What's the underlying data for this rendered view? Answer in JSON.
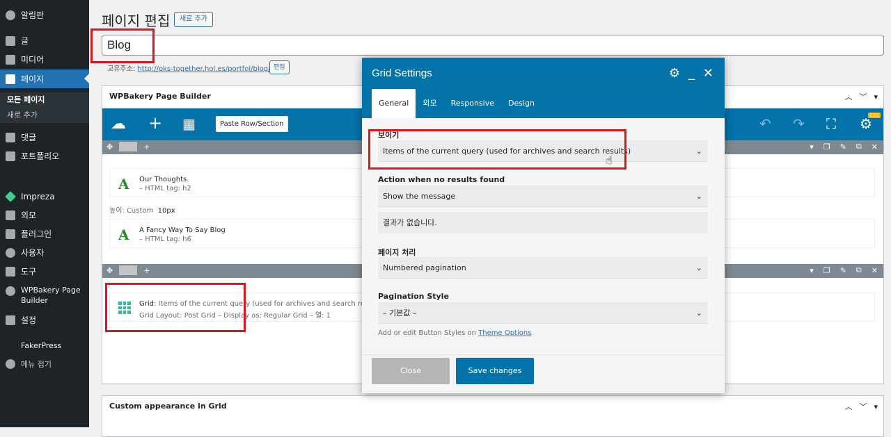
{
  "sidebar": {
    "items": [
      {
        "label": "알림판",
        "icon": "dashboard-icon"
      },
      {
        "label": "글",
        "icon": "pin-icon"
      },
      {
        "label": "미디어",
        "icon": "media-icon"
      },
      {
        "label": "페이지",
        "icon": "page-icon"
      },
      {
        "label": "댓글",
        "icon": "comment-icon"
      },
      {
        "label": "포트폴리오",
        "icon": "portfolio-icon"
      },
      {
        "label": "Impreza",
        "icon": "gem-icon"
      },
      {
        "label": "외모",
        "icon": "brush-icon"
      },
      {
        "label": "플러그인",
        "icon": "plugin-icon"
      },
      {
        "label": "사용자",
        "icon": "user-icon"
      },
      {
        "label": "도구",
        "icon": "wrench-icon"
      },
      {
        "label": "WPBakery Page Builder",
        "icon": "cloud-icon"
      },
      {
        "label": "설정",
        "icon": "settings-icon"
      },
      {
        "label": "FakerPress",
        "icon": ""
      },
      {
        "label": "메뉴 접기",
        "icon": "collapse-icon"
      }
    ],
    "sub": [
      "모든 페이지",
      "새로 추가"
    ]
  },
  "header": {
    "title": "페이지 편집",
    "add_new": "새로 추가",
    "post_title": "Blog",
    "permalink_label": "고유주소:",
    "permalink_url": "http://oks-together.hol.es/portfol/blog/",
    "edit_label": "편집"
  },
  "builder": {
    "title": "WPBakery Page Builder",
    "paste_label": "Paste Row/Section",
    "css_badge": "CSS",
    "elements": [
      {
        "title": "Our Thoughts.",
        "sub": "– HTML tag: h2"
      },
      {
        "title": "A Fancy Way To Say Blog",
        "sub": "– HTML tag: h6"
      }
    ],
    "height_label": "높이: Custom",
    "height_value": "10px",
    "grid_title": "Grid",
    "grid_desc": ": Items of the current query (used for archives and search results)",
    "grid_sub": "Grid Layout: Post Grid – Display as: Regular Grid – 열: 1"
  },
  "custom_panel": {
    "title": "Custom appearance in Grid"
  },
  "modal": {
    "title": "Grid Settings",
    "tabs": [
      "General",
      "외모",
      "Responsive",
      "Design"
    ],
    "fields": {
      "show_label": "보이기",
      "show_value": "Items of the current query (used for archives and search results)",
      "no_results_label": "Action when no results found",
      "no_results_value": "Show the message",
      "message_value": "결과가 없습니다.",
      "pagination_label": "페이지 처리",
      "pagination_value": "Numbered pagination",
      "pagination_style_label": "Pagination Style",
      "pagination_style_value": "– 기본값 –",
      "help_text": "Add or edit Button Styles on",
      "help_link": "Theme Options"
    },
    "close_label": "Close",
    "save_label": "Save changes"
  }
}
